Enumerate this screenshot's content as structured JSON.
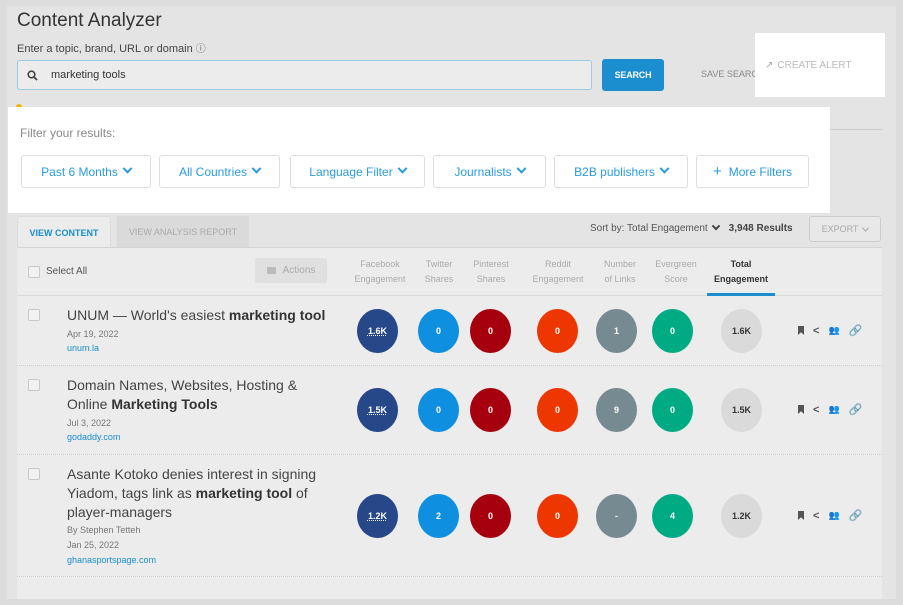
{
  "header": {
    "title": "Content Analyzer",
    "subtitle": "Enter a topic, brand, URL or domain",
    "info_icon": "info-icon"
  },
  "search": {
    "value": "marketing tools",
    "icon": "search-icon",
    "button_label": "SEARCH",
    "save_search_label": "SAVE SEARCH",
    "create_alert_label": "CREATE ALERT"
  },
  "filters": {
    "label": "Filter your results:",
    "buttons": [
      {
        "label": "Past 6 Months"
      },
      {
        "label": "All Countries"
      },
      {
        "label": "Language Filter"
      },
      {
        "label": "Journalists"
      },
      {
        "label": "B2B publishers"
      },
      {
        "label": "More Filters"
      }
    ]
  },
  "tabs": [
    {
      "label": "VIEW CONTENT",
      "active": true
    },
    {
      "label": "VIEW ANALYSIS REPORT",
      "active": false
    }
  ],
  "toolbar": {
    "sort_by": "Sort by: Total Engagement",
    "results": "3,948 Results",
    "export_label": "EXPORT"
  },
  "table": {
    "select_all": "Select All",
    "actions_label": "Actions",
    "columns": [
      {
        "line1": "Facebook",
        "line2": "Engagement"
      },
      {
        "line1": "Twitter",
        "line2": "Shares"
      },
      {
        "line1": "Pinterest",
        "line2": "Shares"
      },
      {
        "line1": "Reddit",
        "line2": "Engagement"
      },
      {
        "line1": "Number",
        "line2": "of Links"
      },
      {
        "line1": "Evergreen",
        "line2": "Score"
      },
      {
        "line1": "Total",
        "line2": "Engagement"
      }
    ],
    "colors": {
      "facebook": "#264788",
      "twitter": "#0f8fe0",
      "pinterest": "#a6000f",
      "reddit": "#ee3600",
      "links": "#768a92",
      "evergreen": "#00aa82",
      "total": "#dadada"
    },
    "rows": [
      {
        "title_plain": "UNUM — World's easiest ",
        "title_bold": "marketing tool",
        "title_tail": "",
        "author": "",
        "date": "Apr 19, 2022",
        "domain": "unum.la",
        "facebook": "1.6K",
        "twitter": "0",
        "pinterest": "0",
        "reddit": "0",
        "links": "1",
        "evergreen": "0",
        "total": "1.6K"
      },
      {
        "title_plain": "Domain Names, Websites, Hosting & Online ",
        "title_bold": "Marketing Tools",
        "title_tail": "",
        "author": "",
        "date": "Jul 3, 2022",
        "domain": "godaddy.com",
        "facebook": "1.5K",
        "twitter": "0",
        "pinterest": "0",
        "reddit": "0",
        "links": "9",
        "evergreen": "0",
        "total": "1.5K"
      },
      {
        "title_plain": "Asante Kotoko denies interest in signing Yiadom, tags link as ",
        "title_bold": "marketing tool",
        "title_tail": " of player-managers",
        "author": "By  Stephen Tetteh",
        "date": "Jan 25, 2022",
        "domain": "ghanasportspage.com",
        "facebook": "1.2K",
        "twitter": "2",
        "pinterest": "0",
        "reddit": "0",
        "links": "-",
        "evergreen": "4",
        "total": "1.2K"
      }
    ],
    "row_icons": [
      "bookmark-icon",
      "share-icon",
      "people-icon",
      "link-icon"
    ]
  }
}
